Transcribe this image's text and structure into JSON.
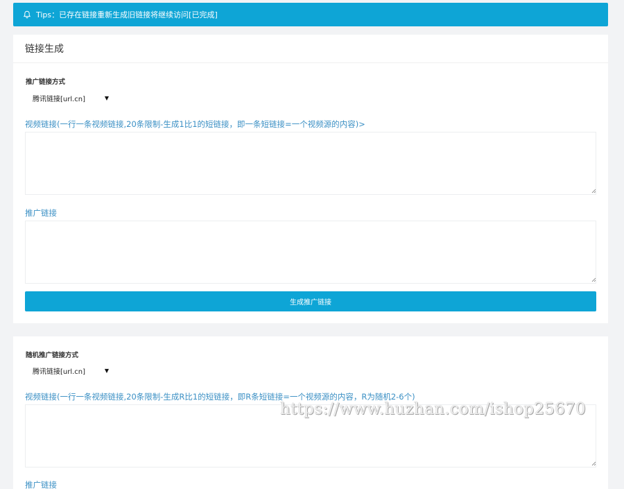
{
  "tips": {
    "icon": "bell-icon",
    "text": "Tips：已存在链接重新生成旧链接将继续访问[已完成]"
  },
  "section1": {
    "title": "链接生成",
    "method_label": "推广链接方式",
    "method_selected": "腾讯链接[url.cn]",
    "video_label": "视频链接(一行一条视频链接,20条限制-生成1比1的短链接，即一条短链接=一个视频源的内容)>",
    "video_value": "",
    "promo_label": "推广链接",
    "promo_value": "",
    "button_label": "生成推广链接"
  },
  "section2": {
    "method_label": "随机推广链接方式",
    "method_selected": "腾讯链接[url.cn]",
    "video_label": "视频链接(一行一条视频链接,20条限制-生成R比1的短链接，即R条短链接=一个视频源的内容，R为随机2-6个)",
    "video_value": "",
    "promo_label": "推广链接"
  },
  "watermark": "https://www.huzhan.com/ishop25670",
  "colors": {
    "accent": "#0ea5d6",
    "label_blue": "#3a8fc4",
    "background": "#f2f3f5"
  }
}
